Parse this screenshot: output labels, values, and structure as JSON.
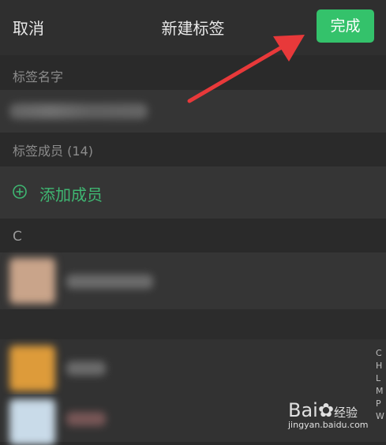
{
  "header": {
    "cancel_label": "取消",
    "title": "新建标签",
    "done_label": "完成"
  },
  "tag_name": {
    "section_label": "标签名字"
  },
  "members": {
    "section_label": "标签成员 (14)",
    "add_label": "添加成员",
    "group_letter": "C"
  },
  "index_bar": [
    "C",
    "H",
    "L",
    "M",
    "P",
    "W"
  ],
  "watermark": {
    "logo": "Bai",
    "logo_suffix": "经验",
    "url": "jingyan.baidu.com"
  },
  "colors": {
    "accent": "#34c26b",
    "annotation_arrow": "#e8393a"
  }
}
